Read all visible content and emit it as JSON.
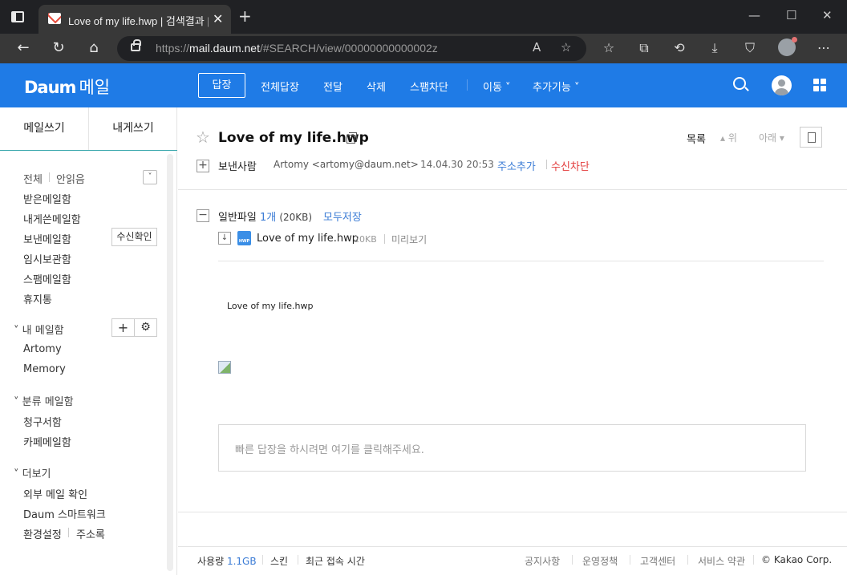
{
  "browser": {
    "tab_title": "Love of my life.hwp | 검색결과 | Daum 메일",
    "url_scheme": "https://",
    "url_host": "mail.daum.net",
    "url_path": "/#SEARCH/view/00000000000002z"
  },
  "header": {
    "logo": "Daum",
    "service": "메일",
    "actions": {
      "reply": "답장",
      "reply_all": "전체답장",
      "forward": "전달",
      "delete": "삭제",
      "block_spam": "스팸차단",
      "move": "이동",
      "more": "추가기능"
    }
  },
  "sidebar": {
    "compose": "메일쓰기",
    "compose_self": "내게쓰기",
    "filter_all": "전체",
    "filter_unread": "안읽음",
    "inbox": "받은메일함",
    "self_box": "내게쓴메일함",
    "sent": "보낸메일함",
    "read_confirm": "수신확인",
    "drafts": "임시보관함",
    "spam": "스팸메일함",
    "trash": "휴지통",
    "my_folders_title": "내 메일함",
    "my_folders": [
      "Artomy",
      "Memory"
    ],
    "category_title": "분류 메일함",
    "category_folders": [
      "청구서함",
      "카페메일함"
    ],
    "more_title": "더보기",
    "external_mail": "외부 메일 확인",
    "smartwork": "Daum 스마트워크",
    "settings": "환경설정",
    "address_book": "주소록"
  },
  "mail": {
    "subject": "Love of my life.hwp",
    "list": "목록",
    "prev": "위",
    "next": "아래",
    "sender_label": "보낸사람",
    "sender": "Artomy <artomy@daum.net>",
    "date": "14.04.30 20:53",
    "add_contact": "주소추가",
    "block_sender": "수신차단",
    "attachments": {
      "label": "일반파일",
      "count": "1개",
      "total_size": "(20KB)",
      "save_all": "모두저장",
      "files": [
        {
          "name": "Love of my life.hwp",
          "size": "20KB",
          "preview": "미리보기",
          "type_badge": "HWP"
        }
      ]
    },
    "body_text": "Love of my life.hwp",
    "quick_reply_placeholder": "빠른 답장을 하시려면 여기를 클릭해주세요."
  },
  "footer": {
    "usage_label": "사용량",
    "usage_value": "1.1GB",
    "skin": "스킨",
    "last_login": "최근 접속 시간",
    "notice": "공지사항",
    "policy": "운영정책",
    "help": "고객센터",
    "terms": "서비스 약관",
    "copyright": "© Kakao Corp."
  },
  "colors": {
    "brand_blue": "#1f7be6",
    "link_blue": "#3a7bd5",
    "danger_red": "#e23b3b",
    "sidebar_accent": "#3aa8ad"
  }
}
